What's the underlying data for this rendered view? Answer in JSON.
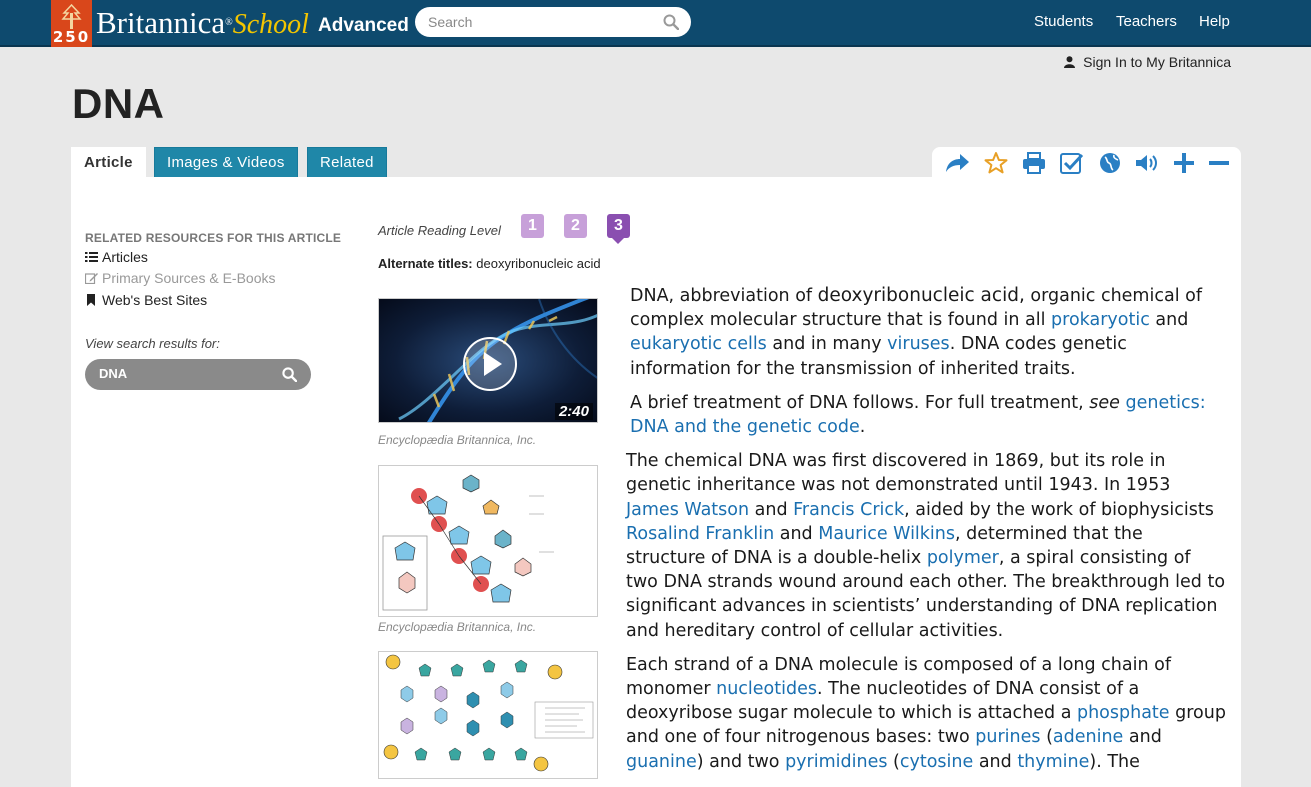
{
  "header": {
    "logo_number": "250",
    "brand_main": "Britannica",
    "brand_school": "School",
    "edition": "Advanced",
    "search_placeholder": "Search",
    "nav": [
      "Students",
      "Teachers",
      "Help"
    ]
  },
  "signin": "Sign In to My Britannica",
  "page_title": "DNA",
  "tabs": [
    "Article",
    "Images & Videos",
    "Related"
  ],
  "toolbar": [
    "share-icon",
    "star-icon",
    "print-icon",
    "checklist-icon",
    "globe-icon",
    "audio-icon",
    "zoom-in-icon",
    "zoom-out-icon"
  ],
  "sidebar": {
    "related_title": "RELATED RESOURCES FOR THIS ARTICLE",
    "items": [
      "Articles",
      "Primary Sources & E-Books",
      "Web's Best Sites"
    ],
    "view_search_label": "View search results for:",
    "search_value": "DNA"
  },
  "reading_level": {
    "label": "Article Reading Level",
    "levels": [
      "1",
      "2",
      "3"
    ],
    "active": "3"
  },
  "alternate_titles": {
    "label": "Alternate titles:",
    "value": "deoxyribonucleic acid"
  },
  "media": [
    {
      "type": "video",
      "duration": "2:40",
      "caption": "Encyclopædia Britannica, Inc."
    },
    {
      "type": "image",
      "caption": "Encyclopædia Britannica, Inc."
    },
    {
      "type": "image",
      "caption": ""
    }
  ],
  "article": {
    "p1": {
      "t1": "DNA, abbreviation of ",
      "t2": "deoxyribonucleic acid,",
      "t3": " organic chemical of complex molecular structure that is found in all ",
      "l1": "prokaryotic",
      "t4": " and ",
      "l2": "eukaryotic cells",
      "t5": " and in many ",
      "l3": "viruses",
      "t6": ". DNA codes genetic information for the transmission of inherited traits."
    },
    "p2": {
      "t1": "A brief treatment of DNA follows. For full treatment, ",
      "see": "see",
      "l1": "genetics: DNA and the genetic code",
      "t2": "."
    },
    "p3": {
      "t1": "The chemical DNA was first discovered in 1869, but its role in genetic inheritance was not demonstrated until 1943. In 1953 ",
      "l1": "James Watson",
      "t2": " and ",
      "l2": "Francis Crick",
      "t3": ", aided by the work of biophysicists ",
      "l3": "Rosalind Franklin",
      "t4": " and ",
      "l4": "Maurice Wilkins",
      "t5": ", determined that the structure of DNA is a double-helix ",
      "l5": "polymer",
      "t6": ", a spiral consisting of two DNA strands wound around each other. The breakthrough led to significant advances in scientists’ understanding of DNA replication and hereditary control of cellular activities."
    },
    "p4": {
      "t1": "Each strand of a DNA molecule is composed of a long chain of monomer ",
      "l1": "nucleotides",
      "t2": ". The nucleotides of DNA consist of a deoxyribose sugar molecule to which is attached a ",
      "l2": "phosphate",
      "t3": " group and one of four nitrogenous bases: two ",
      "l3": "purines",
      "t4": " (",
      "l4": "adenine",
      "t5": " and ",
      "l5": "guanine",
      "t6": ") and two ",
      "l6": "pyrimidines",
      "t7": " (",
      "l7": "cytosine",
      "t8": " and ",
      "l8": "thymine",
      "t9": "). The"
    }
  },
  "colors": {
    "header_bg": "#0e4a6e",
    "tab_bg": "#1f87a8",
    "link": "#1a6fb0",
    "reading_level": "#c7a0d9",
    "reading_level_active": "#8a4fb0",
    "icon": "#2a7fc4",
    "star": "#e8a026"
  }
}
